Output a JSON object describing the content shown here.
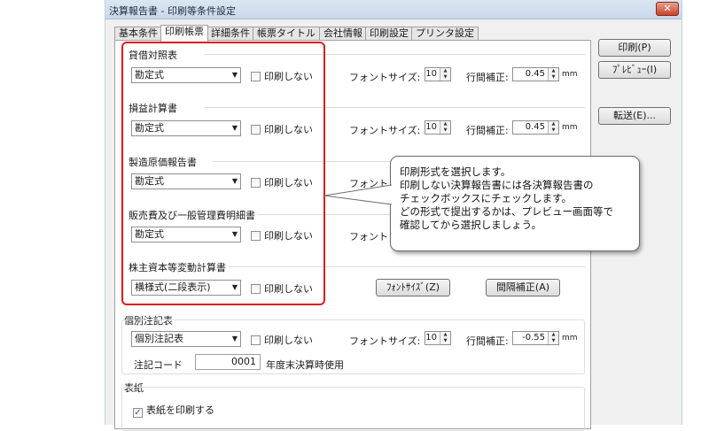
{
  "window": {
    "title": "決算報告書 - 印刷等条件設定",
    "close_label": "✕"
  },
  "tabs": [
    "基本条件",
    "印刷帳票",
    "詳細条件",
    "帳票タイトル",
    "会社情報",
    "印刷設定",
    "プリンタ設定"
  ],
  "active_tab": 1,
  "labels": {
    "no_print": "印刷しない",
    "font_size": "フォントサイズ:",
    "line_adjust": "行間補正:",
    "mm": "mm"
  },
  "sections": [
    {
      "title": "貸借対照表",
      "format": "勘定式",
      "no_print": false,
      "font_size": "10",
      "line_adjust": "0.45"
    },
    {
      "title": "損益計算書",
      "format": "勘定式",
      "no_print": false,
      "font_size": "10",
      "line_adjust": "0.45"
    },
    {
      "title": "製造原価報告書",
      "format": "勘定式",
      "no_print": false,
      "font_label_partial": "フォント"
    },
    {
      "title": "販売費及び一般管理費明細書",
      "format": "勘定式",
      "no_print": false,
      "font_label_partial": "フォント"
    },
    {
      "title": "株主資本等変動計算書",
      "format": "横様式(二段表示)",
      "no_print": false,
      "button_font": "ﾌｫﾝﾄｻｲｽﾞ(Z)",
      "button_spacing": "間隔補正(A)"
    },
    {
      "title": "個別注記表",
      "format": "個別注記表",
      "no_print": false,
      "font_size": "10",
      "line_adjust": "-0.55",
      "code_label": "注記コード",
      "code_value": "0001",
      "code_note": "年度末決算時使用"
    }
  ],
  "cover": {
    "title": "表紙",
    "print_label": "表紙を印刷する",
    "checked": true
  },
  "side_buttons": {
    "print": "印刷(P)",
    "preview": "ﾌﾟﾚﾋﾞｭｰ(I)",
    "transfer": "転送(E)..."
  },
  "callout": {
    "lines": [
      "印刷形式を選択します。",
      "印刷しない決算報告書には各決算報告書の",
      "チェックボックスにチェックします。",
      "どの形式で提出するかは、プレビュー画面等で",
      "確認してから選択しましょう。"
    ]
  }
}
